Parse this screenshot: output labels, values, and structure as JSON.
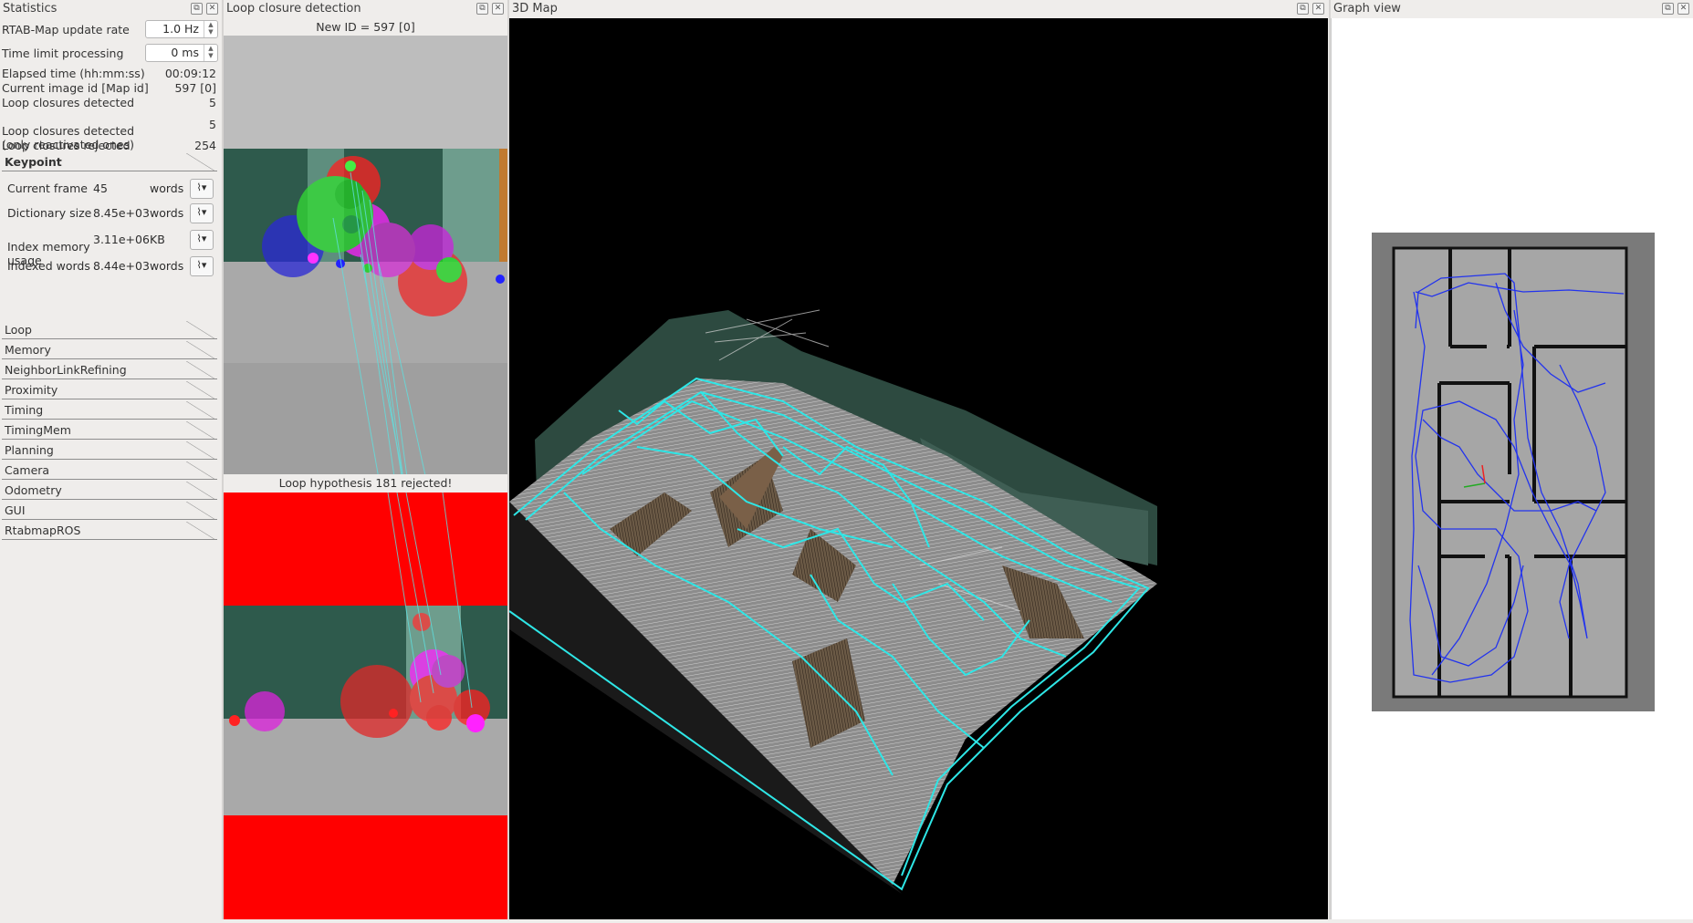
{
  "docks": {
    "statistics": "Statistics",
    "loop": "Loop closure detection",
    "map3d": "3D Map",
    "graph": "Graph view"
  },
  "stats": {
    "update_rate_label": "RTAB-Map update rate",
    "update_rate_value": "1.0 Hz",
    "time_limit_label": "Time limit processing",
    "time_limit_value": "0 ms",
    "rows": [
      {
        "label": "Elapsed time (hh:mm:ss)",
        "value": "00:09:12"
      },
      {
        "label": "Current image id [Map id]",
        "value": "597 [0]"
      },
      {
        "label": "Loop closures detected",
        "value": "5"
      },
      {
        "label": "Loop closures detected\n(only reactivated ones)",
        "value": "5"
      },
      {
        "label": "Loop closures rejected",
        "value": "254"
      }
    ],
    "keypoint": {
      "title": "Keypoint",
      "rows": [
        {
          "label": "Current frame",
          "value": "45",
          "unit": "words"
        },
        {
          "label": "Dictionary size",
          "value": "8.45e+03",
          "unit": "words"
        },
        {
          "label": "Index memory\nusage",
          "value": "3.11e+06",
          "unit": "KB"
        },
        {
          "label": "Indexed words",
          "value": "8.44e+03",
          "unit": "words"
        }
      ]
    },
    "sections": [
      "Loop",
      "Memory",
      "NeighborLinkRefining",
      "Proximity",
      "Timing",
      "TimingMem",
      "Planning",
      "Camera",
      "Odometry",
      "GUI",
      "RtabmapROS"
    ]
  },
  "loop_closure": {
    "new_id": "New ID = 597 [0]",
    "hypothesis": "Loop hypothesis 181 rejected!"
  },
  "colors": {
    "panel_bg": "#efedeb",
    "map_bg": "#000000",
    "trajectory": "#2ee6e6",
    "graph_path": "#2244ee",
    "rejected_red": "#ff0000"
  },
  "icons": [
    "float-icon",
    "close-icon",
    "plot-icon"
  ]
}
